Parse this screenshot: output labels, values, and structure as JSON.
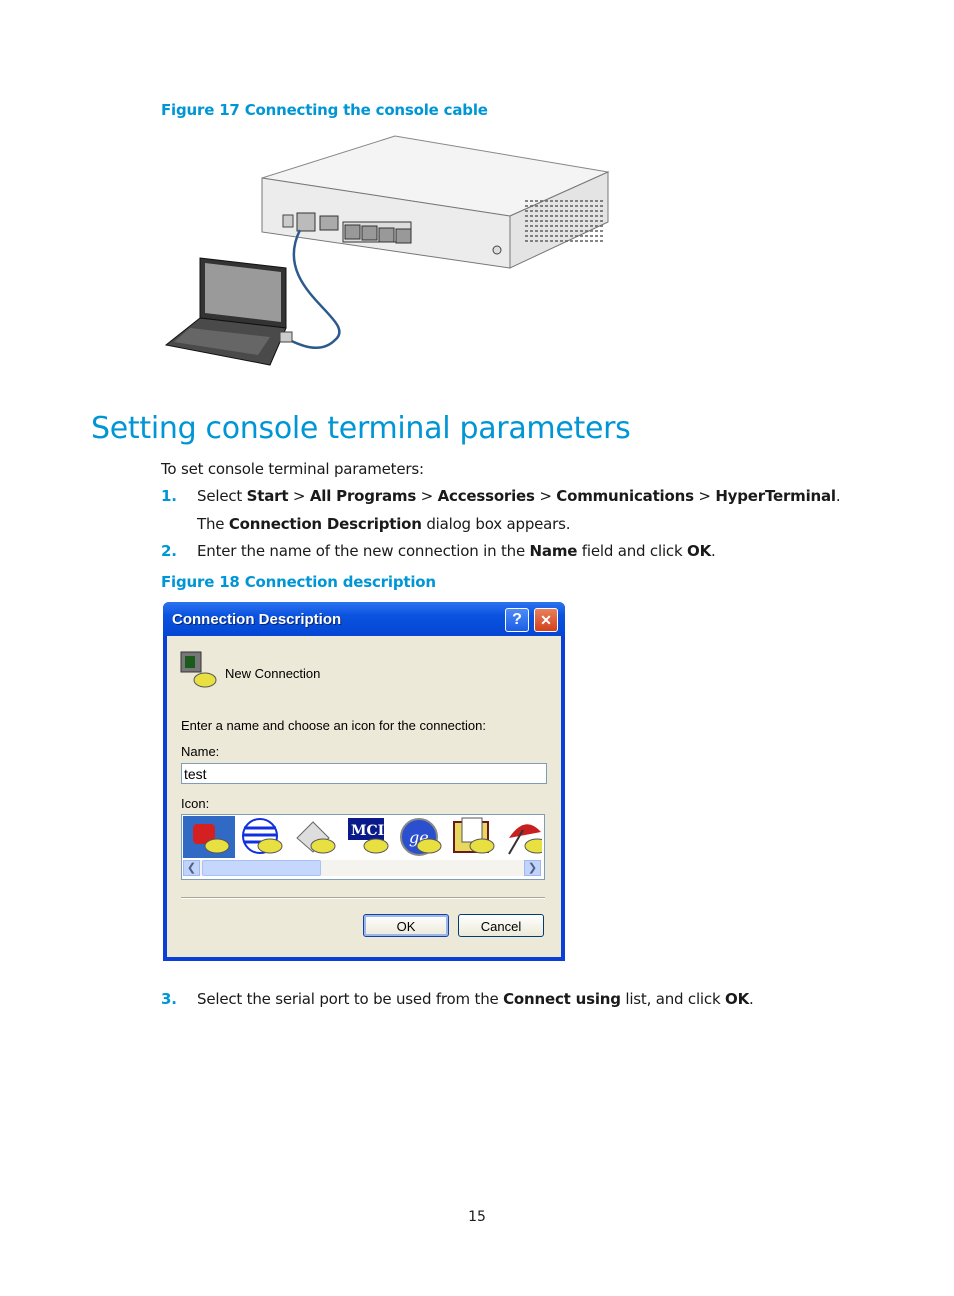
{
  "figure17": {
    "caption": "Figure 17 Connecting the console cable"
  },
  "section": {
    "title": "Setting console terminal parameters"
  },
  "intro": "To set console terminal parameters:",
  "steps": [
    {
      "num": "1.",
      "segments": [
        "Select ",
        "Start",
        " > ",
        "All Programs",
        " > ",
        "Accessories",
        " > ",
        "Communications",
        " > ",
        "HyperTerminal",
        "."
      ],
      "note_segments": [
        "The ",
        "Connection Description",
        " dialog box appears."
      ]
    },
    {
      "num": "2.",
      "segments": [
        "Enter the name of the new connection in the ",
        "Name",
        " field and click ",
        "OK",
        "."
      ]
    },
    {
      "num": "3.",
      "segments": [
        "Select the serial port to be used from the ",
        "Connect using",
        " list, and click ",
        "OK",
        "."
      ]
    }
  ],
  "figure18": {
    "caption": "Figure 18 Connection description"
  },
  "dialog": {
    "title": "Connection Description",
    "help_label": "?",
    "close_label": "✕",
    "header_label": "New Connection",
    "instruction": "Enter a name and choose an icon for the connection:",
    "name_label": "Name:",
    "name_value": "test",
    "icon_label": "Icon:",
    "icons": [
      "red-phone-icon",
      "att-globe-icon",
      "newspaper-icon",
      "mci-icon",
      "ge-icon",
      "documents-icon",
      "umbrella-icon"
    ],
    "selected_icon": 0,
    "ok_label": "OK",
    "cancel_label": "Cancel"
  },
  "page_number": "15",
  "colors": {
    "accent": "#0096d6",
    "dialog_title": "#0a53e0",
    "dialog_body": "#ece9d8"
  }
}
